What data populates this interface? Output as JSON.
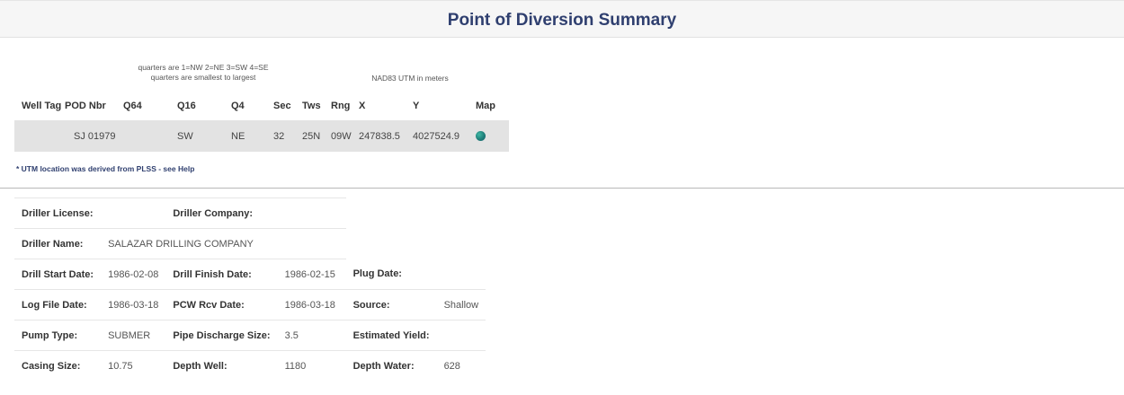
{
  "page_title": "Point of Diversion Summary",
  "notes": {
    "quarters_line1": "quarters are 1=NW 2=NE 3=SW 4=SE",
    "quarters_line2": "quarters are smallest to largest",
    "utm": "NAD83 UTM in meters"
  },
  "pod_table": {
    "headers": [
      "Well Tag",
      "POD Nbr",
      "Q64",
      "Q16",
      "Q4",
      "Sec",
      "Tws",
      "Rng",
      "X",
      "Y",
      "Map"
    ],
    "row": {
      "well_tag": "",
      "pod_nbr": "SJ 01979",
      "q64": "",
      "q16": "SW",
      "q4": "NE",
      "sec": "32",
      "tws": "25N",
      "rng": "09W",
      "x": "247838.5",
      "y": "4027524.9",
      "map_icon": "globe-icon"
    }
  },
  "footnote": {
    "text": "* UTM location was derived from PLSS - ",
    "link": "see Help"
  },
  "details": {
    "driller_license_label": "Driller License:",
    "driller_license": "",
    "driller_company_label": "Driller Company:",
    "driller_company": "",
    "driller_name_label": "Driller Name:",
    "driller_name": "SALAZAR DRILLING COMPANY",
    "drill_start_label": "Drill Start Date:",
    "drill_start": "1986-02-08",
    "drill_finish_label": "Drill Finish Date:",
    "drill_finish": "1986-02-15",
    "plug_date_label": "Plug Date:",
    "plug_date": "",
    "log_file_label": "Log File Date:",
    "log_file": "1986-03-18",
    "pcw_rcv_label": "PCW Rcv Date:",
    "pcw_rcv": "1986-03-18",
    "source_label": "Source:",
    "source": "Shallow",
    "pump_type_label": "Pump Type:",
    "pump_type": "SUBMER",
    "pipe_discharge_label": "Pipe Discharge Size:",
    "pipe_discharge": "3.5",
    "estimated_yield_label": "Estimated Yield:",
    "estimated_yield": "",
    "casing_size_label": "Casing Size:",
    "casing_size": "10.75",
    "depth_well_label": "Depth Well:",
    "depth_well": "1180",
    "depth_water_label": "Depth Water:",
    "depth_water": "628"
  }
}
